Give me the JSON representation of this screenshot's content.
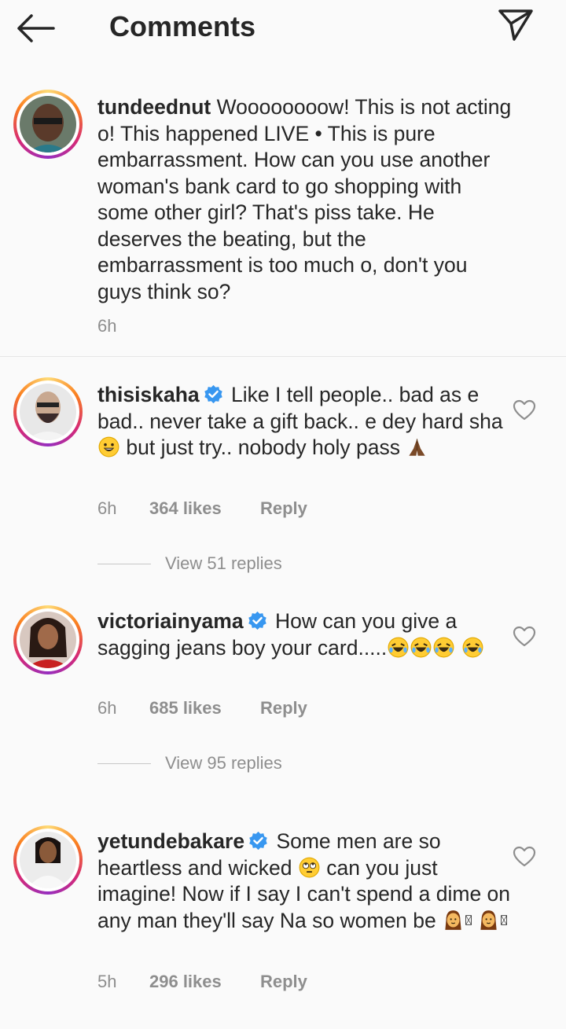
{
  "header": {
    "title": "Comments",
    "back_icon": "arrow-left-icon",
    "send_icon": "paper-plane-icon"
  },
  "caption": {
    "username": "tundeednut",
    "text": " Woooooooow! This is not acting o! This happened LIVE • This is pure embarrassment. How can you use another woman's bank card to go shopping with some other girl? That's piss take. He deserves the beating, but the embarrassment is too much o, don't you guys think so?",
    "time": "6h"
  },
  "comments": [
    {
      "username": "thisiskaha",
      "verified": true,
      "text_before": "Like I tell people.. bad as e bad.. never take a gift back.. e dey hard sha",
      "emoji1": "smiling-face",
      "text_middle": " but just try.. nobody holy pass",
      "emoji2": "folded-hands",
      "time": "6h",
      "likes": "364 likes",
      "reply": "Reply",
      "view_replies": "View 51 replies"
    },
    {
      "username": "victoriainyama",
      "verified": true,
      "text_before": "How can you give a sagging jeans boy your card.....",
      "emojis": [
        "rolling-laughing",
        "rolling-laughing",
        "rolling-laughing",
        "rolling-laughing"
      ],
      "time": "6h",
      "likes": "685 likes",
      "reply": "Reply",
      "view_replies": "View 95 replies"
    },
    {
      "username": "yetundebakare",
      "verified": true,
      "text_before": "Some men are so heartless and wicked",
      "emoji1": "eye-roll",
      "text_middle": " can you just imagine! Now if I say I can't spend a dime on any man they'll say Na so women be",
      "emojis_end": [
        "woman",
        "box",
        "woman",
        "box"
      ],
      "time": "5h",
      "likes": "296 likes",
      "reply": "Reply"
    }
  ],
  "colors": {
    "text": "#262626",
    "muted": "#8e8e8e",
    "verified": "#3897f0",
    "background": "#fafafa"
  }
}
